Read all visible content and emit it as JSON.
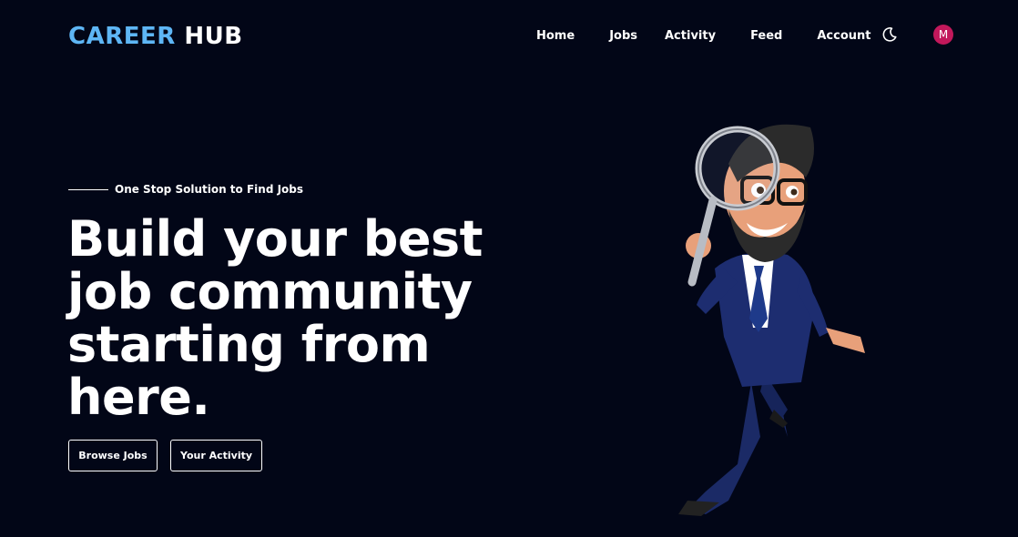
{
  "brand": {
    "accent_text": "CAREER",
    "rest_text": "HUB",
    "accent_color": "#5eb6f5"
  },
  "nav": {
    "items": [
      {
        "label": "Home"
      },
      {
        "label": "Jobs"
      },
      {
        "label": "Activity"
      },
      {
        "label": "Feed"
      },
      {
        "label": "Account"
      }
    ],
    "theme_icon": "moon-icon",
    "avatar_initial": "M",
    "avatar_color": "#c2185b"
  },
  "hero": {
    "tagline": "One Stop Solution to Find Jobs",
    "headline": "Build your best job community starting from here.",
    "buttons": {
      "browse": "Browse Jobs",
      "activity": "Your Activity"
    },
    "illustration": "businessman-with-magnifying-glass"
  },
  "colors": {
    "background": "#020617",
    "text": "#ffffff"
  }
}
